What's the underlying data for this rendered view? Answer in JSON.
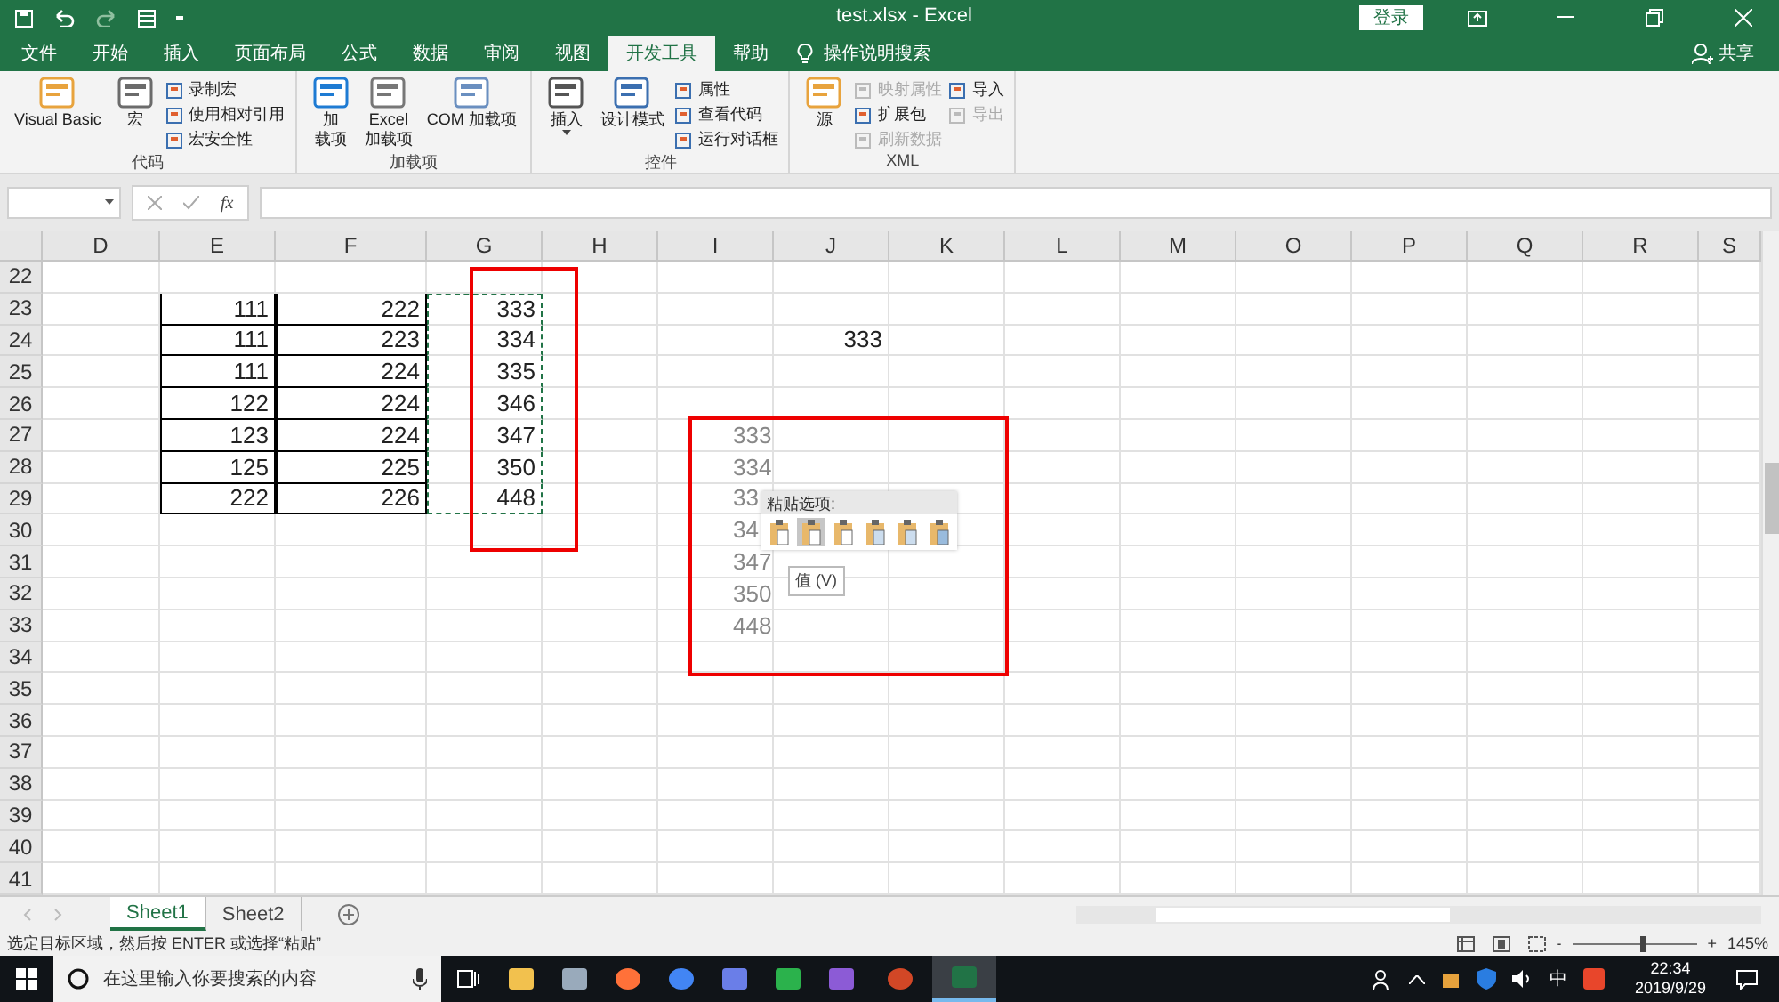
{
  "window": {
    "title": "test.xlsx - Excel",
    "sign_in": "登录",
    "share": "共享"
  },
  "tabs": [
    {
      "label": "文件",
      "selected": false
    },
    {
      "label": "开始",
      "selected": false
    },
    {
      "label": "插入",
      "selected": false
    },
    {
      "label": "页面布局",
      "selected": false
    },
    {
      "label": "公式",
      "selected": false
    },
    {
      "label": "数据",
      "selected": false
    },
    {
      "label": "审阅",
      "selected": false
    },
    {
      "label": "视图",
      "selected": false
    },
    {
      "label": "开发工具",
      "selected": true
    },
    {
      "label": "帮助",
      "selected": false
    }
  ],
  "tell_me": "操作说明搜索",
  "ribbon": [
    {
      "label": "代码",
      "items": [
        {
          "kind": "large",
          "lines": [
            "Visual Basic"
          ]
        },
        {
          "kind": "large",
          "lines": [
            "宏"
          ]
        },
        {
          "kind": "stack",
          "items": [
            {
              "label": "录制宏",
              "disabled": false
            },
            {
              "label": "使用相对引用",
              "disabled": false
            },
            {
              "label": "宏安全性",
              "disabled": false
            }
          ]
        }
      ]
    },
    {
      "label": "加载项",
      "items": [
        {
          "kind": "large",
          "lines": [
            "加",
            "载项"
          ]
        },
        {
          "kind": "large",
          "lines": [
            "Excel",
            "加载项"
          ]
        },
        {
          "kind": "large",
          "lines": [
            "COM 加载项"
          ]
        }
      ]
    },
    {
      "label": "控件",
      "items": [
        {
          "kind": "large",
          "lines": [
            "插入"
          ],
          "dropdown": true
        },
        {
          "kind": "large",
          "lines": [
            "设计模式"
          ]
        },
        {
          "kind": "stack",
          "items": [
            {
              "label": "属性",
              "disabled": false
            },
            {
              "label": "查看代码",
              "disabled": false
            },
            {
              "label": "运行对话框",
              "disabled": false
            }
          ]
        }
      ]
    },
    {
      "label": "XML",
      "items": [
        {
          "kind": "large",
          "lines": [
            "源"
          ]
        },
        {
          "kind": "stack",
          "items": [
            {
              "label": "映射属性",
              "disabled": true
            },
            {
              "label": "扩展包",
              "disabled": false
            },
            {
              "label": "刷新数据",
              "disabled": true
            }
          ]
        },
        {
          "kind": "stack",
          "items": [
            {
              "label": "导入",
              "disabled": false
            },
            {
              "label": "导出",
              "disabled": true
            }
          ]
        }
      ]
    }
  ],
  "formula_bar": {
    "function_label": "fx"
  },
  "sheet": {
    "columns": [
      "D",
      "E",
      "F",
      "G",
      "H",
      "I",
      "J",
      "K",
      "L",
      "M",
      "O",
      "P",
      "Q",
      "R",
      "S"
    ],
    "rows": [
      {
        "label": "22"
      },
      {
        "label": "23",
        "cells": {
          "E": {
            "text": "111",
            "bordered": true
          },
          "F": {
            "text": "222",
            "bordered": true
          },
          "G": {
            "text": "333",
            "copied": true
          }
        }
      },
      {
        "label": "24",
        "cells": {
          "E": {
            "text": "111",
            "bordered": true
          },
          "F": {
            "text": "223",
            "bordered": true
          },
          "G": {
            "text": "334",
            "copied": true
          },
          "J": {
            "text": "333"
          }
        }
      },
      {
        "label": "25",
        "cells": {
          "E": {
            "text": "111",
            "bordered": true
          },
          "F": {
            "text": "224",
            "bordered": true
          },
          "G": {
            "text": "335",
            "copied": true
          }
        }
      },
      {
        "label": "26",
        "cells": {
          "E": {
            "text": "122",
            "bordered": true
          },
          "F": {
            "text": "224",
            "bordered": true
          },
          "G": {
            "text": "346",
            "copied": true
          }
        }
      },
      {
        "label": "27",
        "cells": {
          "E": {
            "text": "123",
            "bordered": true
          },
          "F": {
            "text": "224",
            "bordered": true
          },
          "G": {
            "text": "347",
            "copied": true
          },
          "I": {
            "text": "333",
            "preview": true
          }
        }
      },
      {
        "label": "28",
        "cells": {
          "E": {
            "text": "125",
            "bordered": true
          },
          "F": {
            "text": "225",
            "bordered": true
          },
          "G": {
            "text": "350",
            "copied": true
          },
          "I": {
            "text": "334",
            "preview": true
          }
        }
      },
      {
        "label": "29",
        "cells": {
          "E": {
            "text": "222",
            "bordered": true
          },
          "F": {
            "text": "226",
            "bordered": true
          },
          "G": {
            "text": "448",
            "copied": true
          },
          "I": {
            "text": "33",
            "preview": true
          }
        }
      },
      {
        "label": "30",
        "cells": {
          "I": {
            "text": "34",
            "preview": true
          }
        }
      },
      {
        "label": "31",
        "cells": {
          "I": {
            "text": "347",
            "preview": true
          }
        }
      },
      {
        "label": "32",
        "cells": {
          "I": {
            "text": "350",
            "preview": true
          }
        }
      },
      {
        "label": "33",
        "cells": {
          "I": {
            "text": "448",
            "preview": true
          }
        }
      },
      {
        "label": "34"
      },
      {
        "label": "35"
      },
      {
        "label": "36"
      },
      {
        "label": "37"
      },
      {
        "label": "38"
      },
      {
        "label": "39"
      },
      {
        "label": "40"
      },
      {
        "label": "41"
      }
    ]
  },
  "paste_options": {
    "title": "粘贴选项:",
    "options": [
      {
        "selected": false
      },
      {
        "selected": true
      },
      {
        "selected": false
      },
      {
        "selected": false
      },
      {
        "selected": false
      },
      {
        "selected": false
      }
    ],
    "tooltip": "值 (V)"
  },
  "sheet_tabs": [
    {
      "label": "Sheet1",
      "selected": true
    },
    {
      "label": "Sheet2",
      "selected": false
    }
  ],
  "status_bar": {
    "message": "选定目标区域，然后按 ENTER 或选择“粘贴”",
    "zoom_out": "-",
    "zoom_in": "+",
    "zoom": "145%",
    "level": 0.57
  },
  "taskbar": {
    "search_placeholder": "在这里输入你要搜索的内容",
    "ime": "中",
    "time": "22:34",
    "date": "2019/9/29"
  }
}
